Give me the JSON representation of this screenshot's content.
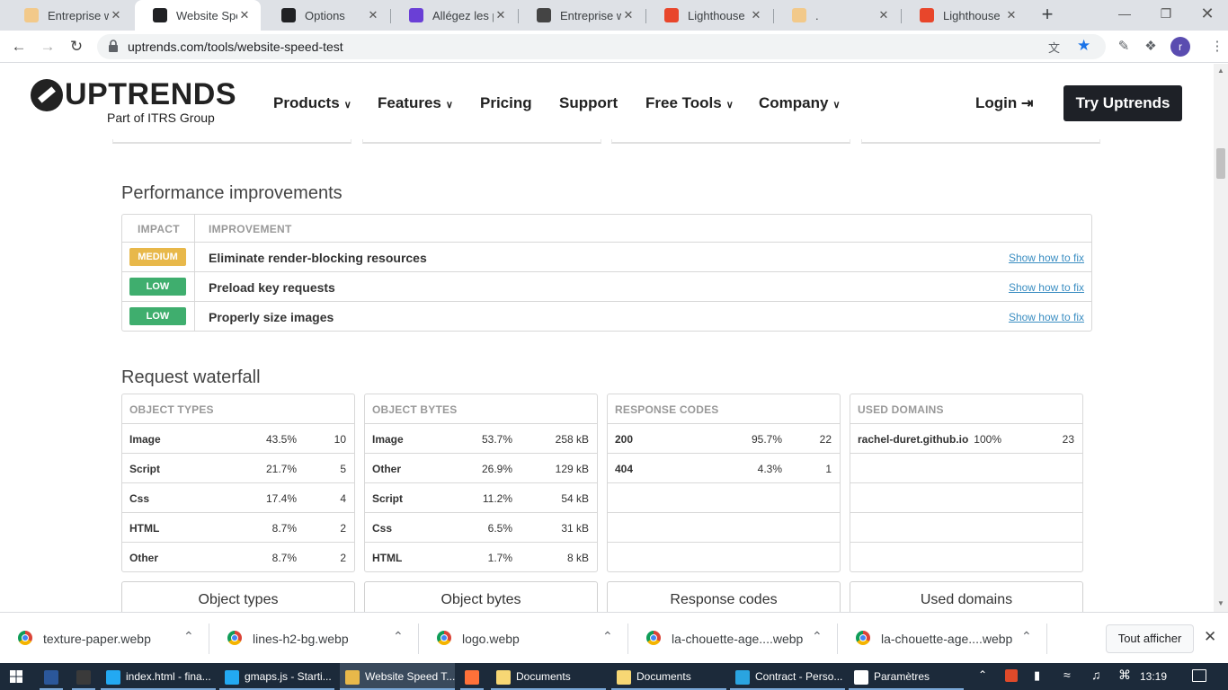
{
  "browser": {
    "tabs": [
      {
        "title": "Entreprise web",
        "favicon_color": "#f2c98a"
      },
      {
        "title": "Website Speed",
        "favicon_color": "#202124"
      },
      {
        "title": "Options",
        "favicon_color": "#202124"
      },
      {
        "title": "Allégez les pag",
        "favicon_color": "#6a3fd6"
      },
      {
        "title": "Entreprise web",
        "favicon_color": "#444444"
      },
      {
        "title": "Lighthouse Rep",
        "favicon_color": "#e8462b"
      },
      {
        "title": ".",
        "favicon_color": "#f2c98a"
      },
      {
        "title": "Lighthouse Rep",
        "favicon_color": "#e8462b"
      }
    ],
    "active_tab_index": 1,
    "url": "uptrends.com/tools/website-speed-test",
    "profile_initial": "r"
  },
  "site": {
    "logo_text": "UPTRENDS",
    "logo_sub": "Part of ITRS Group",
    "nav": [
      {
        "label": "Products",
        "dropdown": true
      },
      {
        "label": "Features",
        "dropdown": true
      },
      {
        "label": "Pricing",
        "dropdown": false
      },
      {
        "label": "Support",
        "dropdown": false
      },
      {
        "label": "Free Tools",
        "dropdown": true
      },
      {
        "label": "Company",
        "dropdown": true
      }
    ],
    "login_label": "Login",
    "cta_label": "Try Uptrends"
  },
  "performance": {
    "heading": "Performance improvements",
    "col_impact": "IMPACT",
    "col_improvement": "IMPROVEMENT",
    "rows": [
      {
        "impact": "MEDIUM",
        "color": "#e8b84a",
        "text": "Eliminate render-blocking resources",
        "link": "Show how to fix"
      },
      {
        "impact": "LOW",
        "color": "#3fae6e",
        "text": "Preload key requests",
        "link": "Show how to fix"
      },
      {
        "impact": "LOW",
        "color": "#3fae6e",
        "text": "Properly size images",
        "link": "Show how to fix"
      }
    ]
  },
  "waterfall": {
    "heading": "Request waterfall",
    "tables": [
      {
        "header": "OBJECT TYPES",
        "button": "Object types",
        "rows": [
          {
            "name": "Image",
            "pct": "43.5%",
            "val": "10"
          },
          {
            "name": "Script",
            "pct": "21.7%",
            "val": "5"
          },
          {
            "name": "Css",
            "pct": "17.4%",
            "val": "4"
          },
          {
            "name": "HTML",
            "pct": "8.7%",
            "val": "2"
          },
          {
            "name": "Other",
            "pct": "8.7%",
            "val": "2"
          }
        ]
      },
      {
        "header": "OBJECT BYTES",
        "button": "Object bytes",
        "rows": [
          {
            "name": "Image",
            "pct": "53.7%",
            "val": "258 kB"
          },
          {
            "name": "Other",
            "pct": "26.9%",
            "val": "129 kB"
          },
          {
            "name": "Script",
            "pct": "11.2%",
            "val": "54 kB"
          },
          {
            "name": "Css",
            "pct": "6.5%",
            "val": "31 kB"
          },
          {
            "name": "HTML",
            "pct": "1.7%",
            "val": "8 kB"
          }
        ]
      },
      {
        "header": "RESPONSE CODES",
        "button": "Response codes",
        "rows": [
          {
            "name": "200",
            "pct": "95.7%",
            "val": "22"
          },
          {
            "name": "404",
            "pct": "4.3%",
            "val": "1"
          },
          {
            "name": "",
            "pct": "",
            "val": ""
          },
          {
            "name": "",
            "pct": "",
            "val": ""
          },
          {
            "name": "",
            "pct": "",
            "val": ""
          }
        ]
      },
      {
        "header": "USED DOMAINS",
        "button": "Used domains",
        "rows": [
          {
            "name": "rachel-duret.github.io",
            "pct": "100%",
            "val": "23"
          },
          {
            "name": "",
            "pct": "",
            "val": ""
          },
          {
            "name": "",
            "pct": "",
            "val": ""
          },
          {
            "name": "",
            "pct": "",
            "val": ""
          },
          {
            "name": "",
            "pct": "",
            "val": ""
          }
        ]
      }
    ]
  },
  "downloads": {
    "items": [
      "texture-paper.webp",
      "lines-h2-bg.webp",
      "logo.webp",
      "la-chouette-age....webp",
      "la-chouette-age....webp"
    ],
    "show_all": "Tout afficher"
  },
  "taskbar": {
    "items": [
      {
        "label": "",
        "icon_color": "#2b579a"
      },
      {
        "label": "",
        "icon_color": "#3a3a3a"
      },
      {
        "label": "index.html - fina...",
        "icon_color": "#23a9f2"
      },
      {
        "label": "gmaps.js - Starti...",
        "icon_color": "#23a9f2"
      },
      {
        "label": "Website Speed T...",
        "icon_color": "#e8b84a"
      },
      {
        "label": "",
        "icon_color": "#ff7139"
      },
      {
        "label": "Documents",
        "icon_color": "#f7d774"
      },
      {
        "label": "Documents",
        "icon_color": "#f7d774"
      },
      {
        "label": "Contract - Perso...",
        "icon_color": "#2aa4e0"
      },
      {
        "label": "Paramètres",
        "icon_color": "#ffffff"
      }
    ],
    "clock": "13:19"
  }
}
